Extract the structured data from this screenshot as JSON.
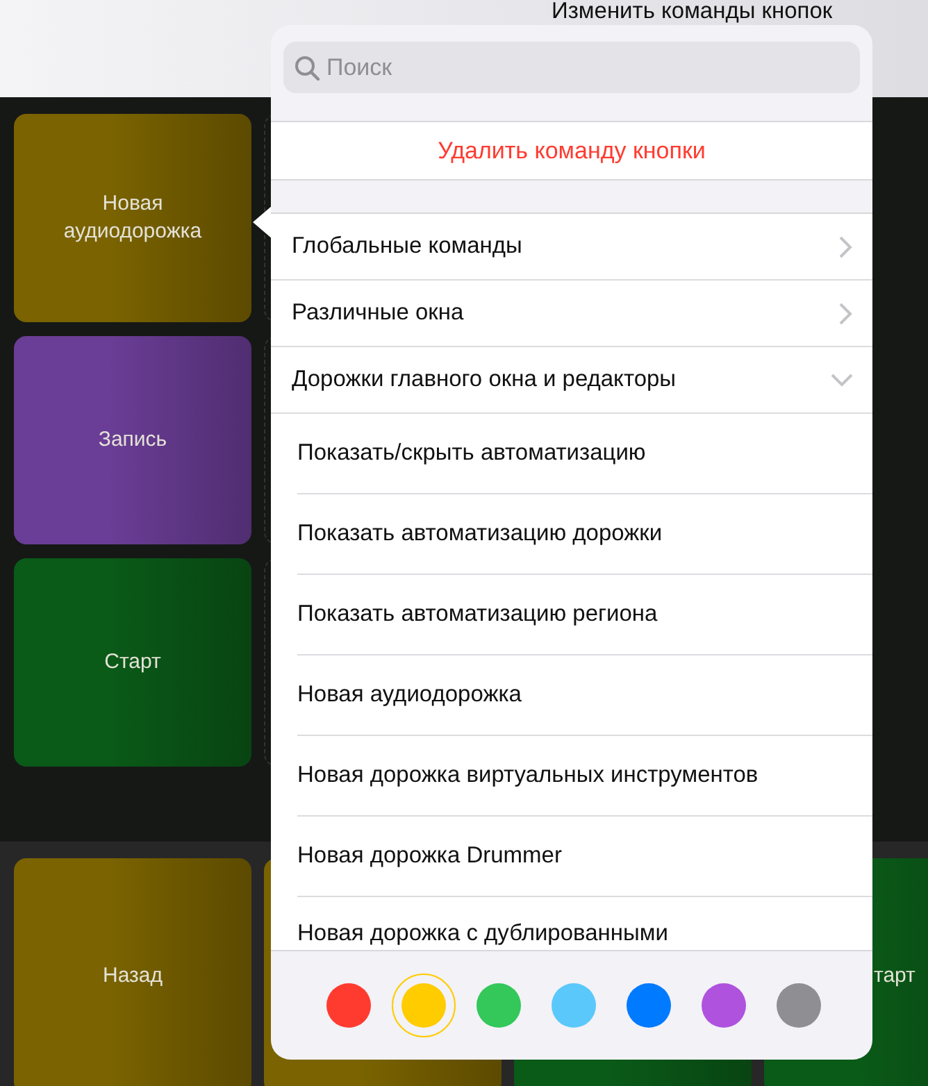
{
  "header": {
    "title": "Изменить команды кнопок"
  },
  "pads": [
    {
      "label": "Новая аудиодорожка",
      "color": "#7a6300"
    },
    {
      "label": "Запись",
      "color": "#6a3d96"
    },
    {
      "label": "Старт",
      "color": "#0a5a18"
    }
  ],
  "bottom_pads": [
    {
      "label": "Назад",
      "color": "#7a6300"
    },
    {
      "color": "#7a6300"
    },
    {
      "color": "#0a5a18"
    },
    {
      "label": "тарт",
      "color": "#0a5a18"
    }
  ],
  "popover": {
    "search": {
      "placeholder": "Поиск"
    },
    "delete_action": "Удалить команду кнопки",
    "categories": [
      {
        "label": "Глобальные команды",
        "expanded": false
      },
      {
        "label": "Различные окна",
        "expanded": false
      },
      {
        "label": "Дорожки главного окна и редакторы",
        "expanded": true
      }
    ],
    "commands": [
      "Показать/скрыть автоматизацию",
      "Показать автоматизацию дорожки",
      "Показать автоматизацию региона",
      "Новая аудиодорожка",
      "Новая дорожка виртуальных инструментов",
      "Новая дорожка Drummer",
      "Новая дорожка с дублированными"
    ],
    "colors": [
      {
        "color": "#ff3b30",
        "selected": false
      },
      {
        "color": "#ffcc00",
        "selected": true
      },
      {
        "color": "#34c759",
        "selected": false
      },
      {
        "color": "#5ac8fa",
        "selected": false
      },
      {
        "color": "#007aff",
        "selected": false
      },
      {
        "color": "#af52de",
        "selected": false
      },
      {
        "color": "#8e8e93",
        "selected": false
      }
    ]
  }
}
